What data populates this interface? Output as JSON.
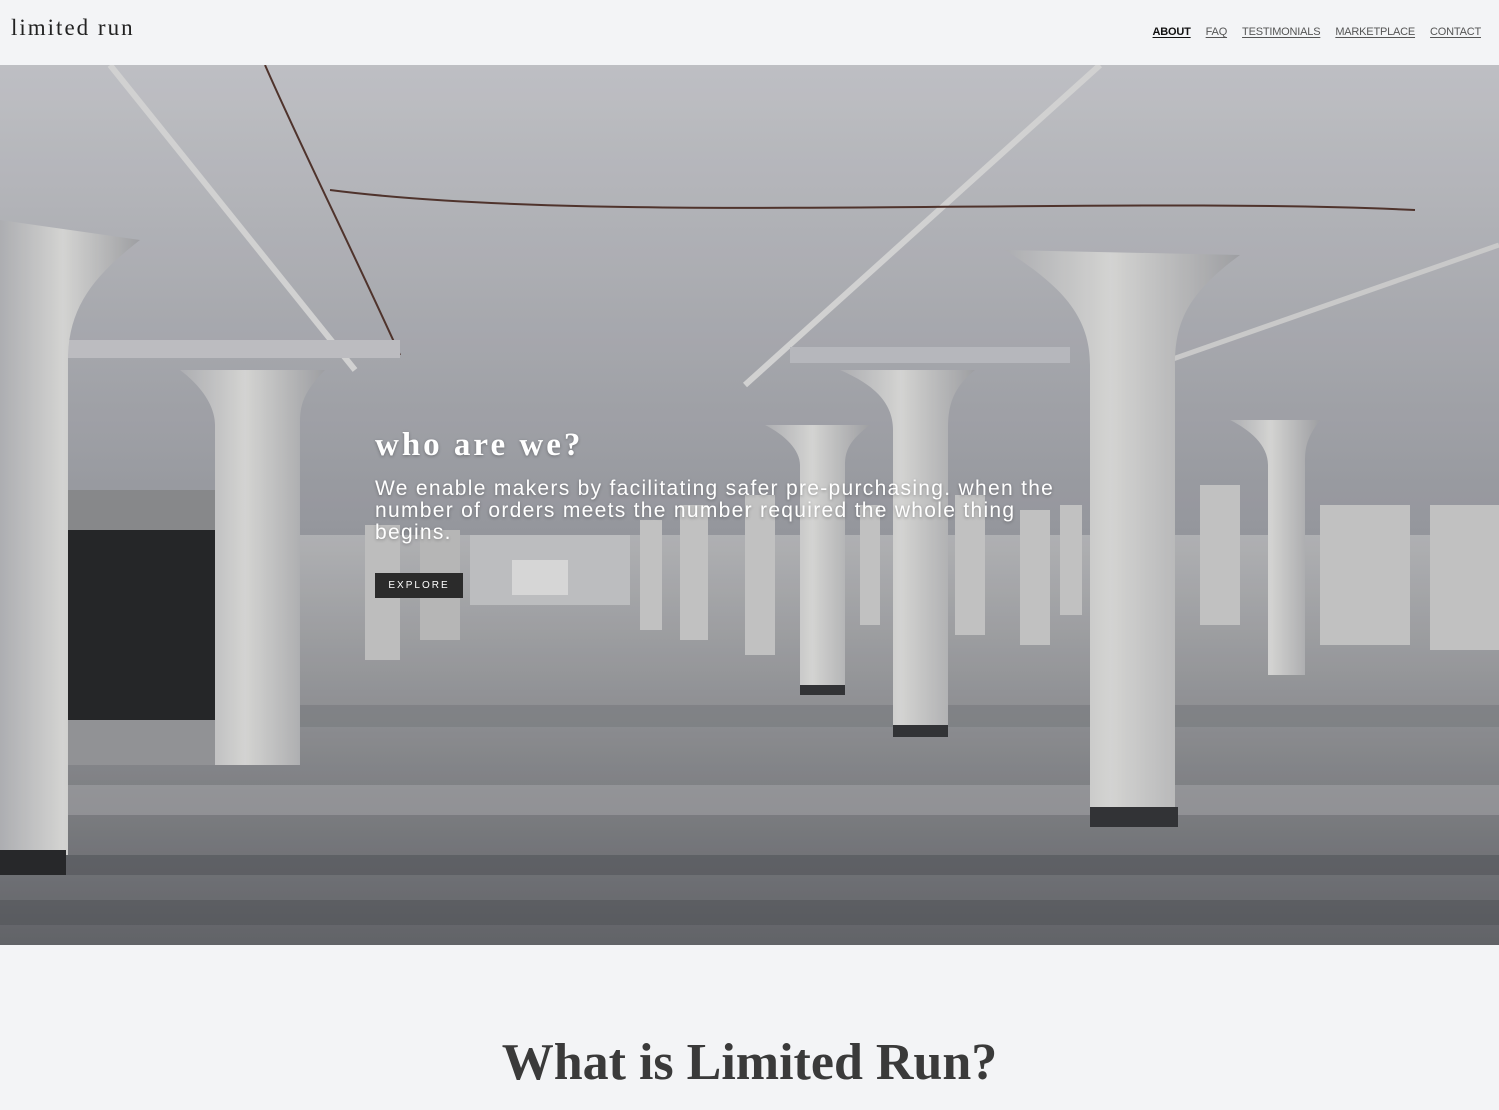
{
  "header": {
    "logo": "limited run",
    "nav": [
      {
        "label": "ABOUT",
        "active": true
      },
      {
        "label": "FAQ",
        "active": false
      },
      {
        "label": "TESTIMONIALS",
        "active": false
      },
      {
        "label": "MARKETPLACE",
        "active": false
      },
      {
        "label": "CONTACT",
        "active": false
      }
    ]
  },
  "hero": {
    "title": "who are we?",
    "text": "We enable makers by facilitating safer pre-purchasing. when the number of orders meets the number required the whole thing begins.",
    "button": "EXPLORE"
  },
  "section": {
    "title": "What is Limited Run?"
  }
}
